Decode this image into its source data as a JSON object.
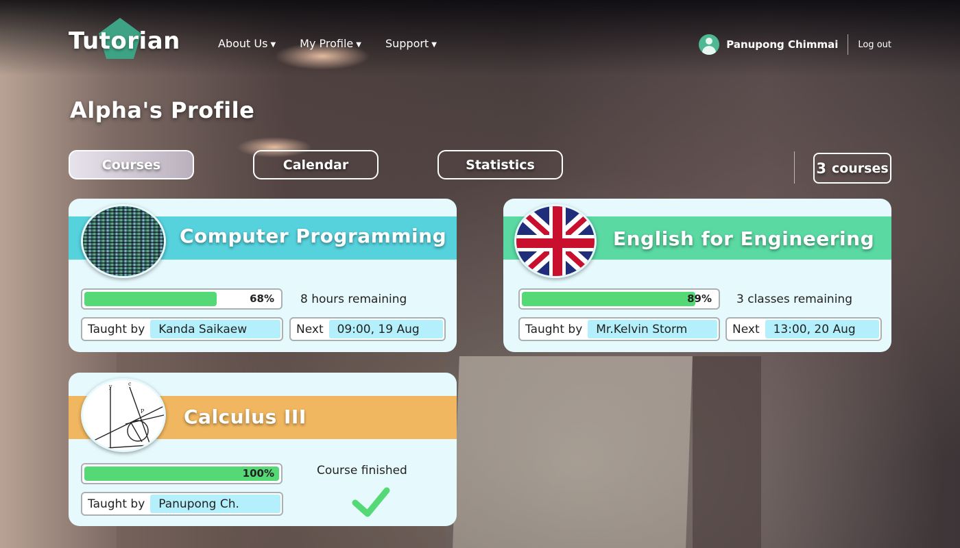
{
  "brand": {
    "name": "Tutorian"
  },
  "nav": [
    {
      "label": "About Us"
    },
    {
      "label": "My Profile"
    },
    {
      "label": "Support"
    }
  ],
  "user": {
    "name": "Panupong Chimmai",
    "logout": "Log out",
    "avatar_icon": "user-avatar-icon"
  },
  "page": {
    "title": "Alpha's Profile"
  },
  "tabs": [
    {
      "label": "Courses",
      "active": true
    },
    {
      "label": "Calendar",
      "active": false
    },
    {
      "label": "Statistics",
      "active": false
    }
  ],
  "course_count": {
    "number": "3",
    "label": "courses"
  },
  "courses": [
    {
      "title": "Computer Programming",
      "band_color": "#56d2dd",
      "image": "code-screen",
      "progress": 68,
      "progress_label": "68%",
      "remaining": "8 hours remaining",
      "taught_by_label": "Taught by",
      "teacher": "Kanda Saikaew",
      "next_label": "Next",
      "next": "09:00, 19 Aug"
    },
    {
      "title": "English for Engineering",
      "band_color": "#5ad9a3",
      "image": "uk-flag",
      "progress": 89,
      "progress_label": "89%",
      "remaining": "3 classes remaining",
      "taught_by_label": "Taught by",
      "teacher": "Mr.Kelvin Storm",
      "next_label": "Next",
      "next": "13:00, 20 Aug"
    },
    {
      "title": "Calculus III",
      "band_color": "#f1b760",
      "image": "geometry-sketch",
      "progress": 100,
      "progress_label": "100%",
      "status": "Course finished",
      "status_icon": "checkmark-icon",
      "taught_by_label": "Taught by",
      "teacher": "Panupong Ch."
    }
  ]
}
